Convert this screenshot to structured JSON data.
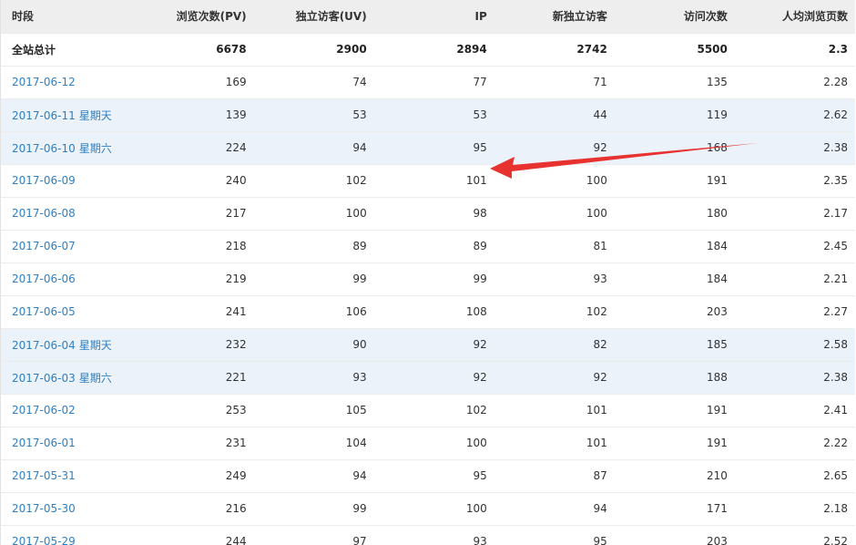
{
  "table": {
    "headers": [
      "时段",
      "浏览次数(PV)",
      "独立访客(UV)",
      "IP",
      "新独立访客",
      "访问次数",
      "人均浏览页数"
    ],
    "total": {
      "label": "全站总计",
      "values": [
        "6678",
        "2900",
        "2894",
        "2742",
        "5500",
        "2.3"
      ]
    },
    "rows": [
      {
        "date": "2017-06-12",
        "weekday": "",
        "values": [
          "169",
          "74",
          "77",
          "71",
          "135",
          "2.28"
        ]
      },
      {
        "date": "2017-06-11",
        "weekday": "星期天",
        "values": [
          "139",
          "53",
          "53",
          "44",
          "119",
          "2.62"
        ]
      },
      {
        "date": "2017-06-10",
        "weekday": "星期六",
        "values": [
          "224",
          "94",
          "95",
          "92",
          "168",
          "2.38"
        ]
      },
      {
        "date": "2017-06-09",
        "weekday": "",
        "values": [
          "240",
          "102",
          "101",
          "100",
          "191",
          "2.35"
        ]
      },
      {
        "date": "2017-06-08",
        "weekday": "",
        "values": [
          "217",
          "100",
          "98",
          "100",
          "180",
          "2.17"
        ]
      },
      {
        "date": "2017-06-07",
        "weekday": "",
        "values": [
          "218",
          "89",
          "89",
          "81",
          "184",
          "2.45"
        ]
      },
      {
        "date": "2017-06-06",
        "weekday": "",
        "values": [
          "219",
          "99",
          "99",
          "93",
          "184",
          "2.21"
        ]
      },
      {
        "date": "2017-06-05",
        "weekday": "",
        "values": [
          "241",
          "106",
          "108",
          "102",
          "203",
          "2.27"
        ]
      },
      {
        "date": "2017-06-04",
        "weekday": "星期天",
        "values": [
          "232",
          "90",
          "92",
          "82",
          "185",
          "2.58"
        ]
      },
      {
        "date": "2017-06-03",
        "weekday": "星期六",
        "values": [
          "221",
          "93",
          "92",
          "92",
          "188",
          "2.38"
        ]
      },
      {
        "date": "2017-06-02",
        "weekday": "",
        "values": [
          "253",
          "105",
          "102",
          "101",
          "191",
          "2.41"
        ]
      },
      {
        "date": "2017-06-01",
        "weekday": "",
        "values": [
          "231",
          "104",
          "100",
          "101",
          "191",
          "2.22"
        ]
      },
      {
        "date": "2017-05-31",
        "weekday": "",
        "values": [
          "249",
          "94",
          "95",
          "87",
          "210",
          "2.65"
        ]
      },
      {
        "date": "2017-05-30",
        "weekday": "",
        "values": [
          "216",
          "99",
          "100",
          "94",
          "171",
          "2.18"
        ]
      },
      {
        "date": "2017-05-29",
        "weekday": "",
        "values": [
          "244",
          "97",
          "93",
          "95",
          "203",
          "2.52"
        ]
      }
    ]
  },
  "annotation": {
    "icon": "red-arrow-icon",
    "color": "#e8322f"
  },
  "colors": {
    "link": "#2f7fc0",
    "weekend_row": "#ebf2fa",
    "header_bg": "#eeeeee"
  }
}
